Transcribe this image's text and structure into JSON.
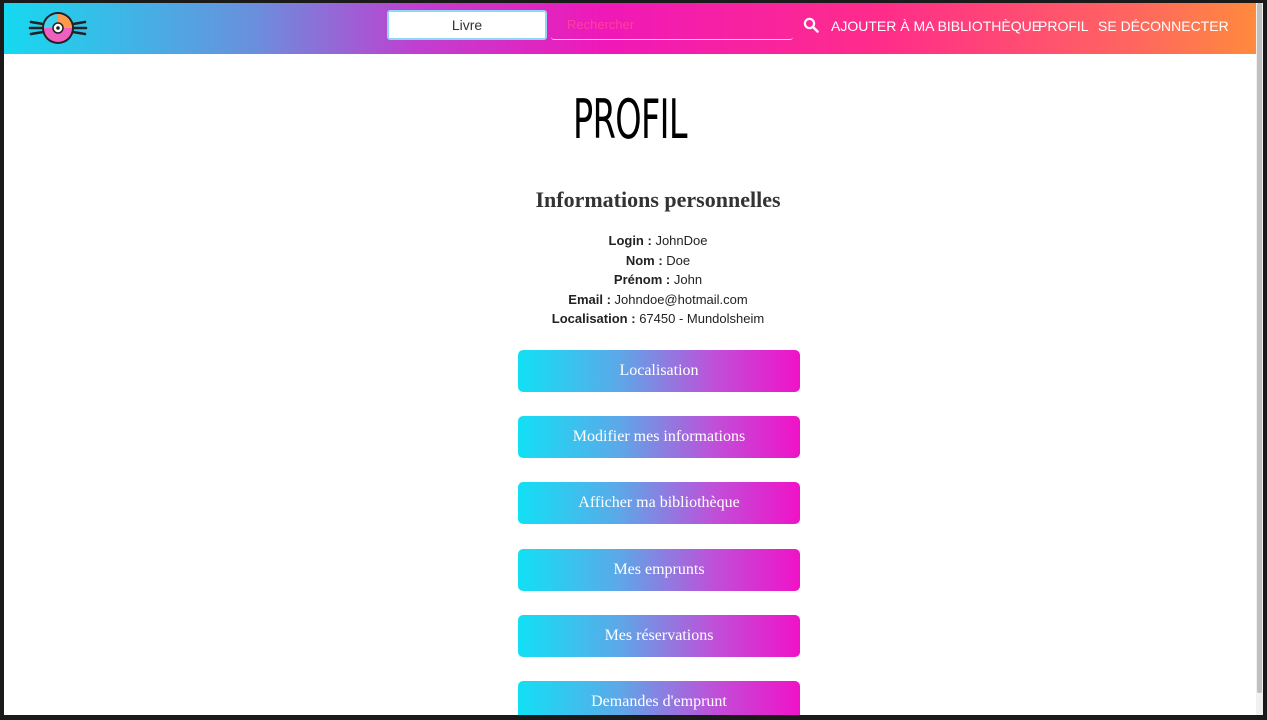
{
  "navbar": {
    "logo_icon": "book-disc-logo",
    "category_value": "Livre",
    "search_placeholder": "Rechercher",
    "search_icon": "search-icon",
    "links": {
      "add_to_library": "AJOUTER À MA BIBLIOTHÈQUE",
      "profile": "PROFIL",
      "logout": "SE DÉCONNECTER"
    },
    "gradient_colors": [
      "#16d9f0",
      "#f018b8",
      "#ff8a3d"
    ]
  },
  "page": {
    "title": "PROFIL",
    "section_title": "Informations personnelles",
    "info": {
      "login_label": "Login :",
      "login_value": "JohnDoe",
      "nom_label": "Nom :",
      "nom_value": "Doe",
      "prenom_label": "Prénom :",
      "prenom_value": "John",
      "email_label": "Email :",
      "email_value": "Johndoe@hotmail.com",
      "localisation_label": "Localisation :",
      "localisation_value": "67450 - Mundolsheim"
    },
    "buttons": {
      "localisation": "Localisation",
      "edit_info": "Modifier mes informations",
      "show_library": "Afficher ma bibliothèque",
      "loans": "Mes emprunts",
      "reservations": "Mes réservations",
      "loan_requests": "Demandes d'emprunt"
    }
  }
}
